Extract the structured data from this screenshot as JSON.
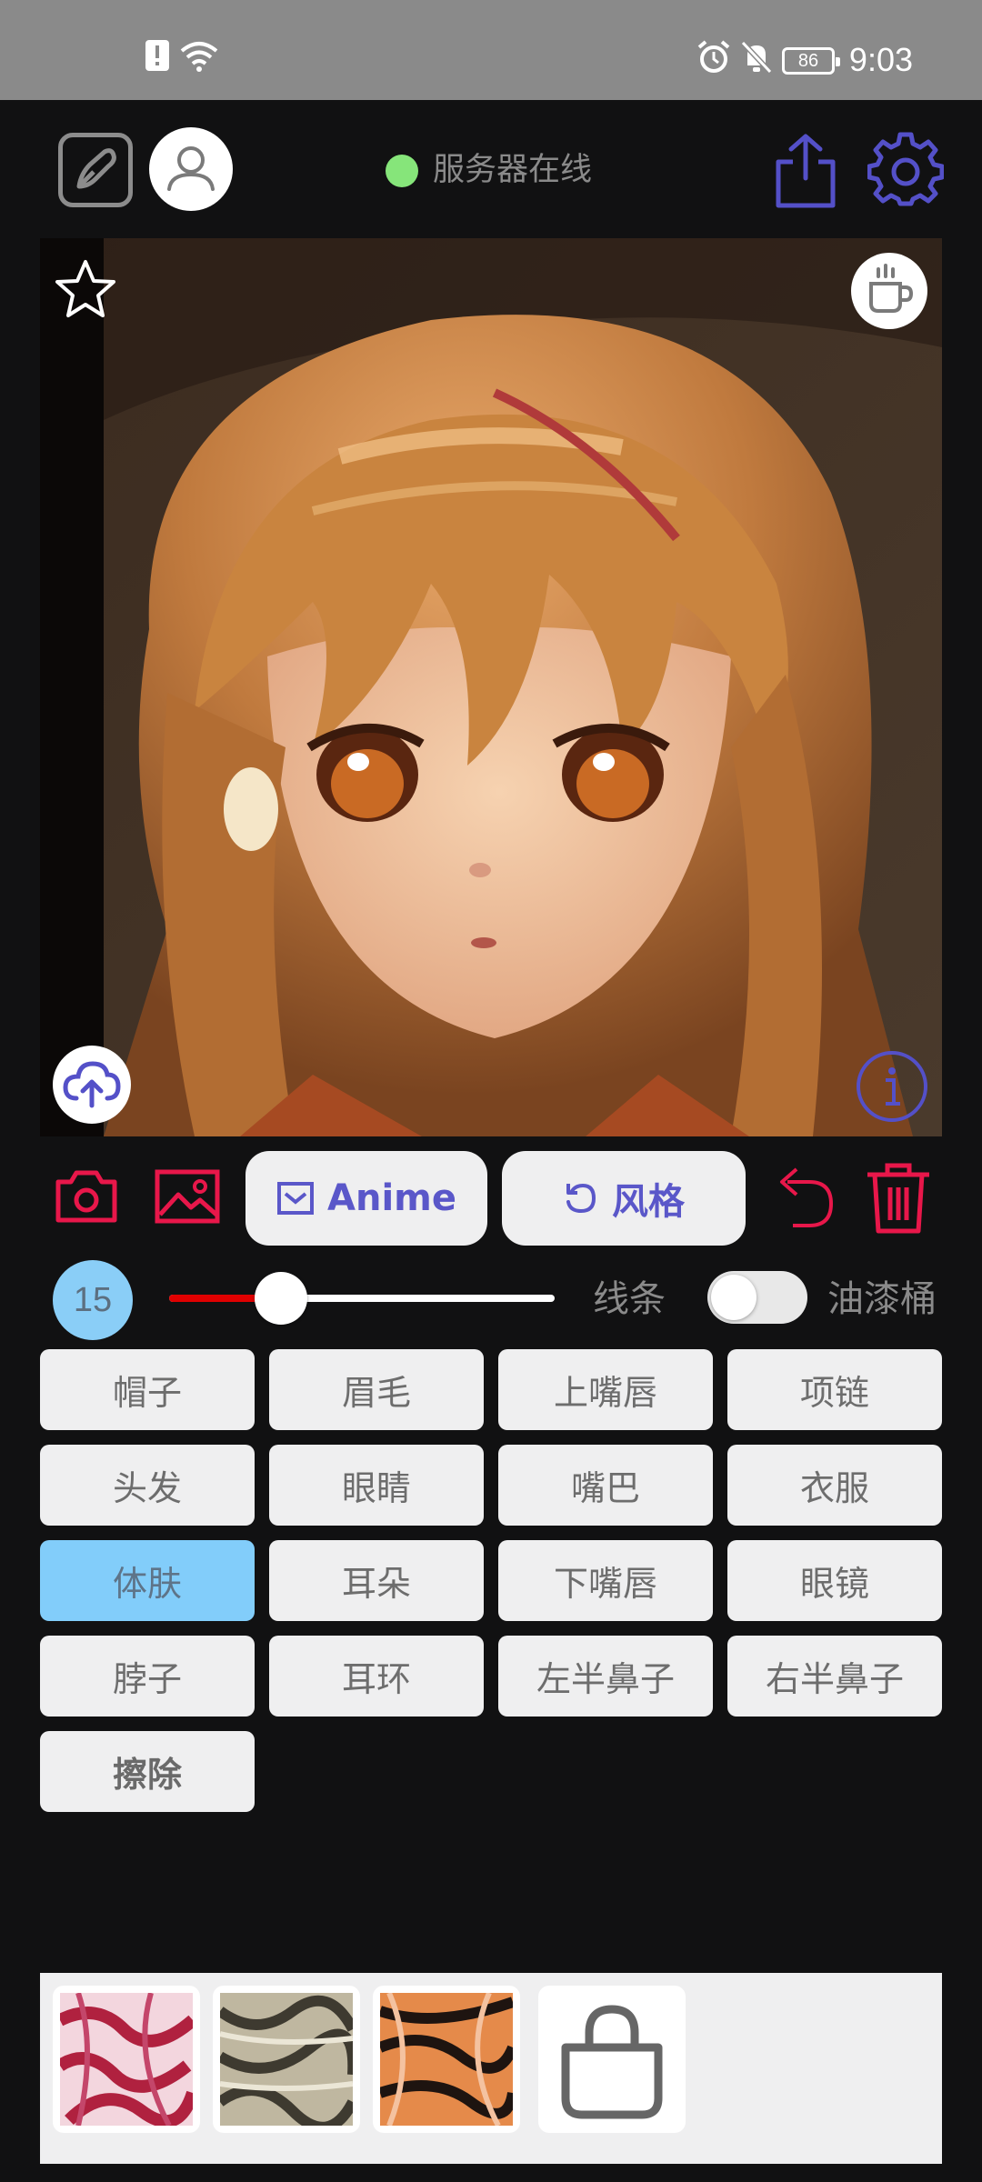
{
  "status_bar": {
    "time": "9:03",
    "battery": "86",
    "icons": [
      "alert-icon",
      "wifi-icon",
      "alarm-icon",
      "mute-icon",
      "battery-icon"
    ]
  },
  "toolbar": {
    "server_status": "服务器在线",
    "server_status_color": "#86e57a",
    "icons": [
      "edit-icon",
      "user-icon",
      "share-icon",
      "settings-icon"
    ]
  },
  "canvas": {
    "icons": [
      "star-icon",
      "coffee-icon",
      "upload-icon",
      "info-icon"
    ]
  },
  "actions": {
    "anime_label": "Anime",
    "style_label": "风格",
    "icons": [
      "camera-icon",
      "gallery-icon",
      "undo-icon",
      "trash-icon"
    ],
    "accent_color": "#e8174a",
    "brand_color": "#5a57c9"
  },
  "brush": {
    "size": "15",
    "slider_value": 0.29,
    "line_label": "线条",
    "bucket_label": "油漆桶",
    "bucket_enabled": false
  },
  "parts": [
    {
      "label": "帽子",
      "selected": false
    },
    {
      "label": "眉毛",
      "selected": false
    },
    {
      "label": "上嘴唇",
      "selected": false
    },
    {
      "label": "项链",
      "selected": false
    },
    {
      "label": "头发",
      "selected": false
    },
    {
      "label": "眼睛",
      "selected": false
    },
    {
      "label": "嘴巴",
      "selected": false
    },
    {
      "label": "衣服",
      "selected": false
    },
    {
      "label": "体肤",
      "selected": true
    },
    {
      "label": "耳朵",
      "selected": false
    },
    {
      "label": "下嘴唇",
      "selected": false
    },
    {
      "label": "眼镜",
      "selected": false
    },
    {
      "label": "脖子",
      "selected": false
    },
    {
      "label": "耳环",
      "selected": false
    },
    {
      "label": "左半鼻子",
      "selected": false
    },
    {
      "label": "右半鼻子",
      "selected": false
    },
    {
      "label": "擦除",
      "selected": false
    }
  ],
  "textures": [
    "texture-pink",
    "texture-gray",
    "texture-tiger",
    "shop-icon"
  ]
}
